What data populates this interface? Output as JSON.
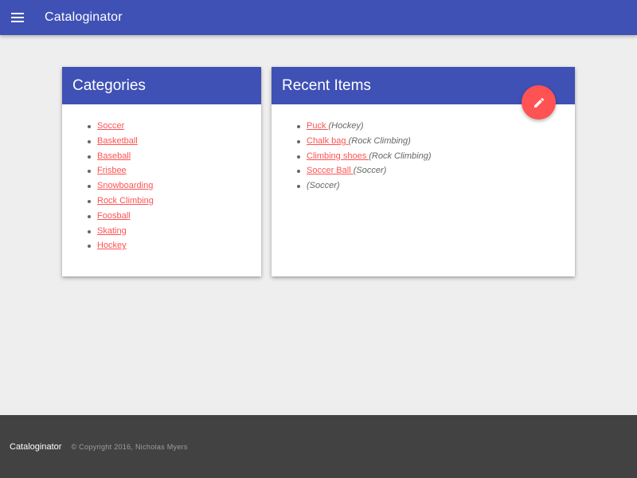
{
  "appbar": {
    "title": "Cataloginator",
    "menu_icon": "menu-icon"
  },
  "categories": {
    "title": "Categories",
    "items": [
      "Soccer",
      "Basketball",
      "Baseball",
      "Frisbee",
      "Snowboarding",
      "Rock Climbing",
      "Foosball",
      "Skating",
      "Hockey"
    ]
  },
  "recent": {
    "title": "Recent Items",
    "fab_icon": "edit-icon",
    "items": [
      {
        "name": "Puck ",
        "category": "(Hockey)"
      },
      {
        "name": "Chalk bag ",
        "category": "(Rock Climbing)"
      },
      {
        "name": "Climbing shoes ",
        "category": "(Rock Climbing)"
      },
      {
        "name": "Soccer Ball ",
        "category": "(Soccer)"
      },
      {
        "name": " ",
        "category": "(Soccer)"
      }
    ]
  },
  "footer": {
    "brand": "Cataloginator",
    "copyright": "© Copyright 2016, Nicholas Myers"
  },
  "colors": {
    "primary": "#3f51b5",
    "accent": "#ff5252",
    "background": "#eeeeee",
    "footer": "#424242"
  }
}
